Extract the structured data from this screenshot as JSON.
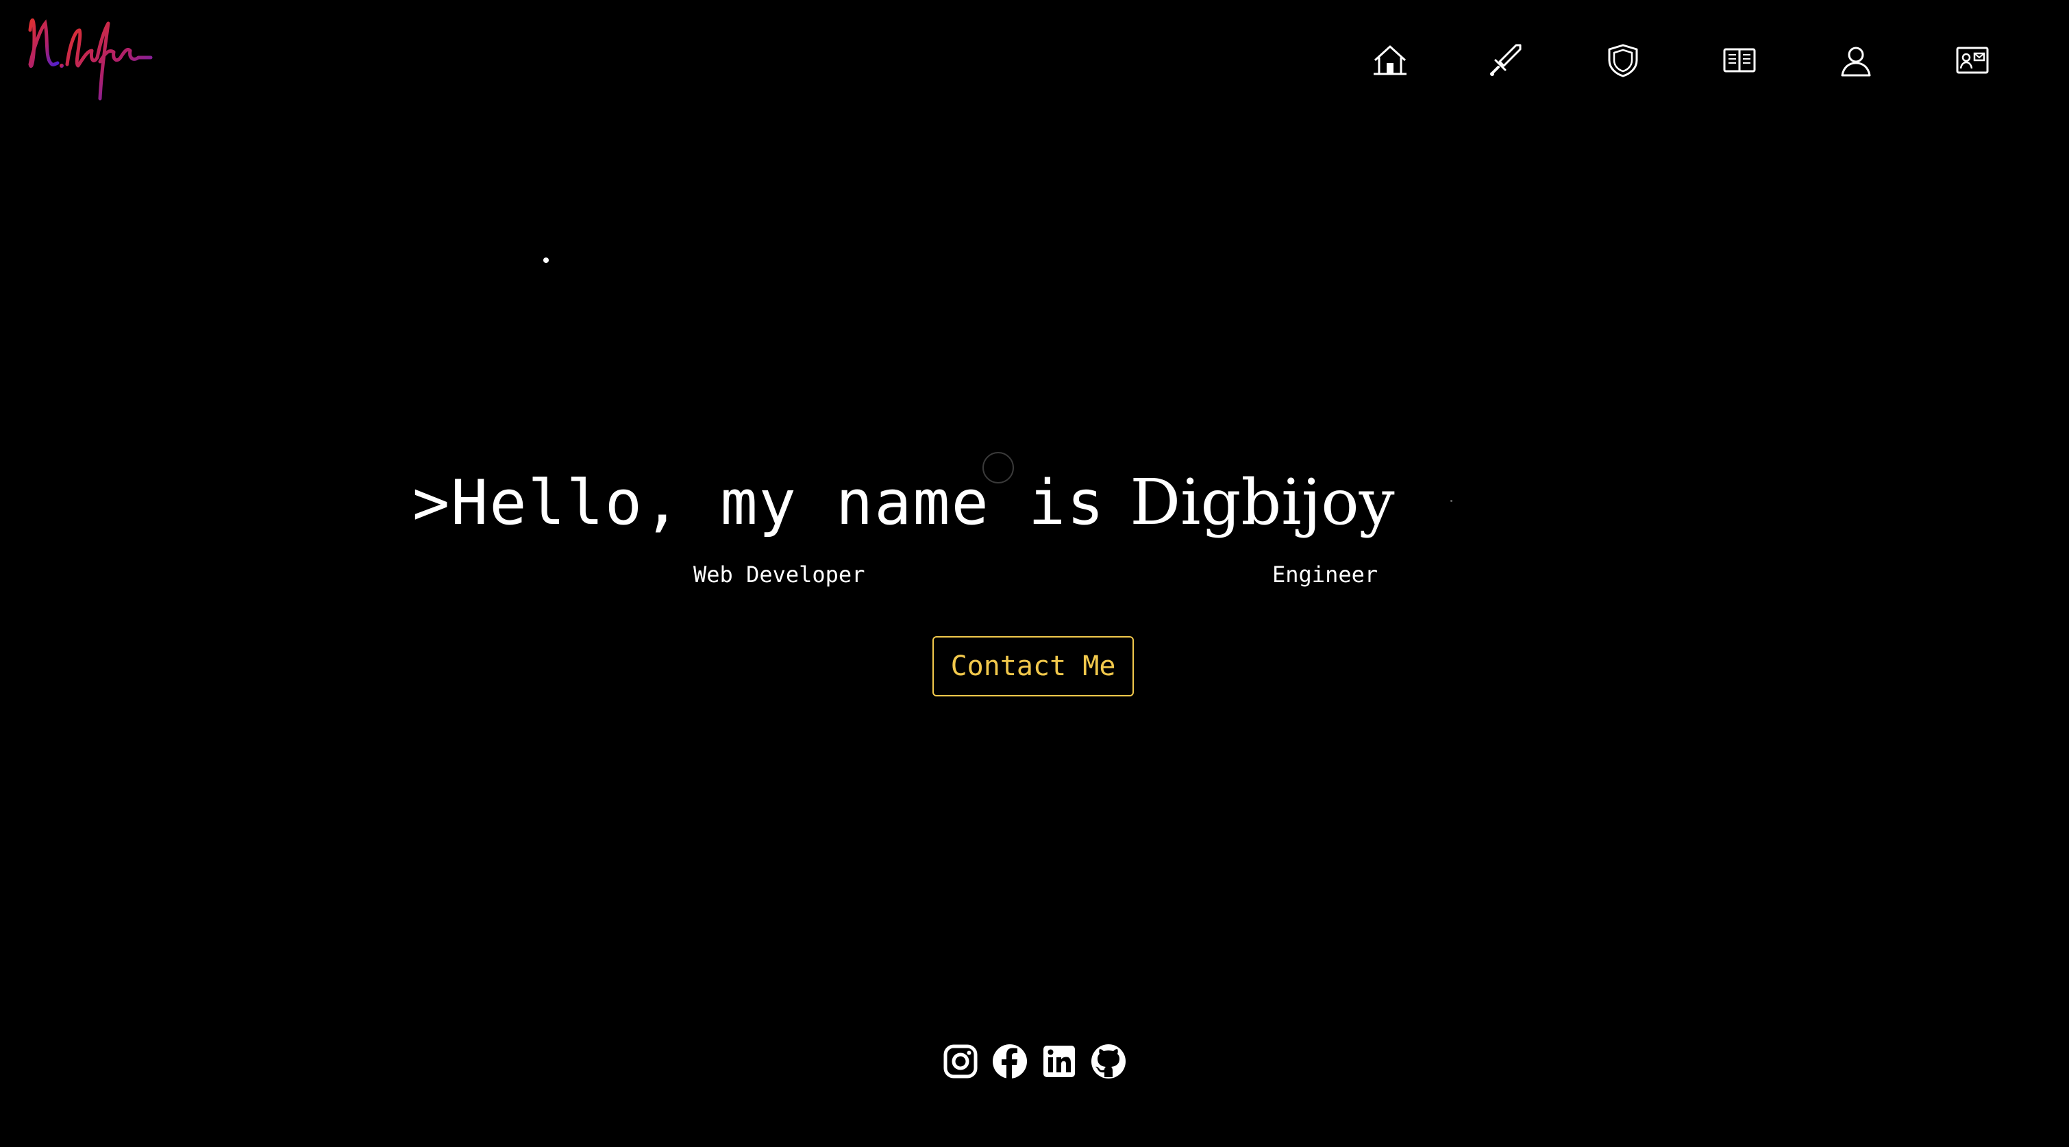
{
  "header": {
    "logo_icon": "signature-logo-icon",
    "nav": [
      {
        "name": "home",
        "icon": "house-icon"
      },
      {
        "name": "skills",
        "icon": "sword-icon"
      },
      {
        "name": "security",
        "icon": "shield-icon"
      },
      {
        "name": "blog",
        "icon": "book-icon"
      },
      {
        "name": "about",
        "icon": "person-icon"
      },
      {
        "name": "contact",
        "icon": "contact-card-icon"
      }
    ]
  },
  "hero": {
    "prefix": ">Hello, my name is",
    "name": "Digbijoy",
    "roles": [
      "Web Developer",
      "Engineer"
    ],
    "contact_label": "Contact Me"
  },
  "socials": [
    {
      "name": "instagram",
      "icon": "instagram-icon"
    },
    {
      "name": "facebook",
      "icon": "facebook-icon"
    },
    {
      "name": "linkedin",
      "icon": "linkedin-icon"
    },
    {
      "name": "github",
      "icon": "github-icon"
    }
  ],
  "colors": {
    "background": "#000000",
    "text": "#ffffff",
    "accent": "#f2c94c",
    "logo_gradient_start": "#e0312f",
    "logo_gradient_end": "#4b1fd6"
  }
}
